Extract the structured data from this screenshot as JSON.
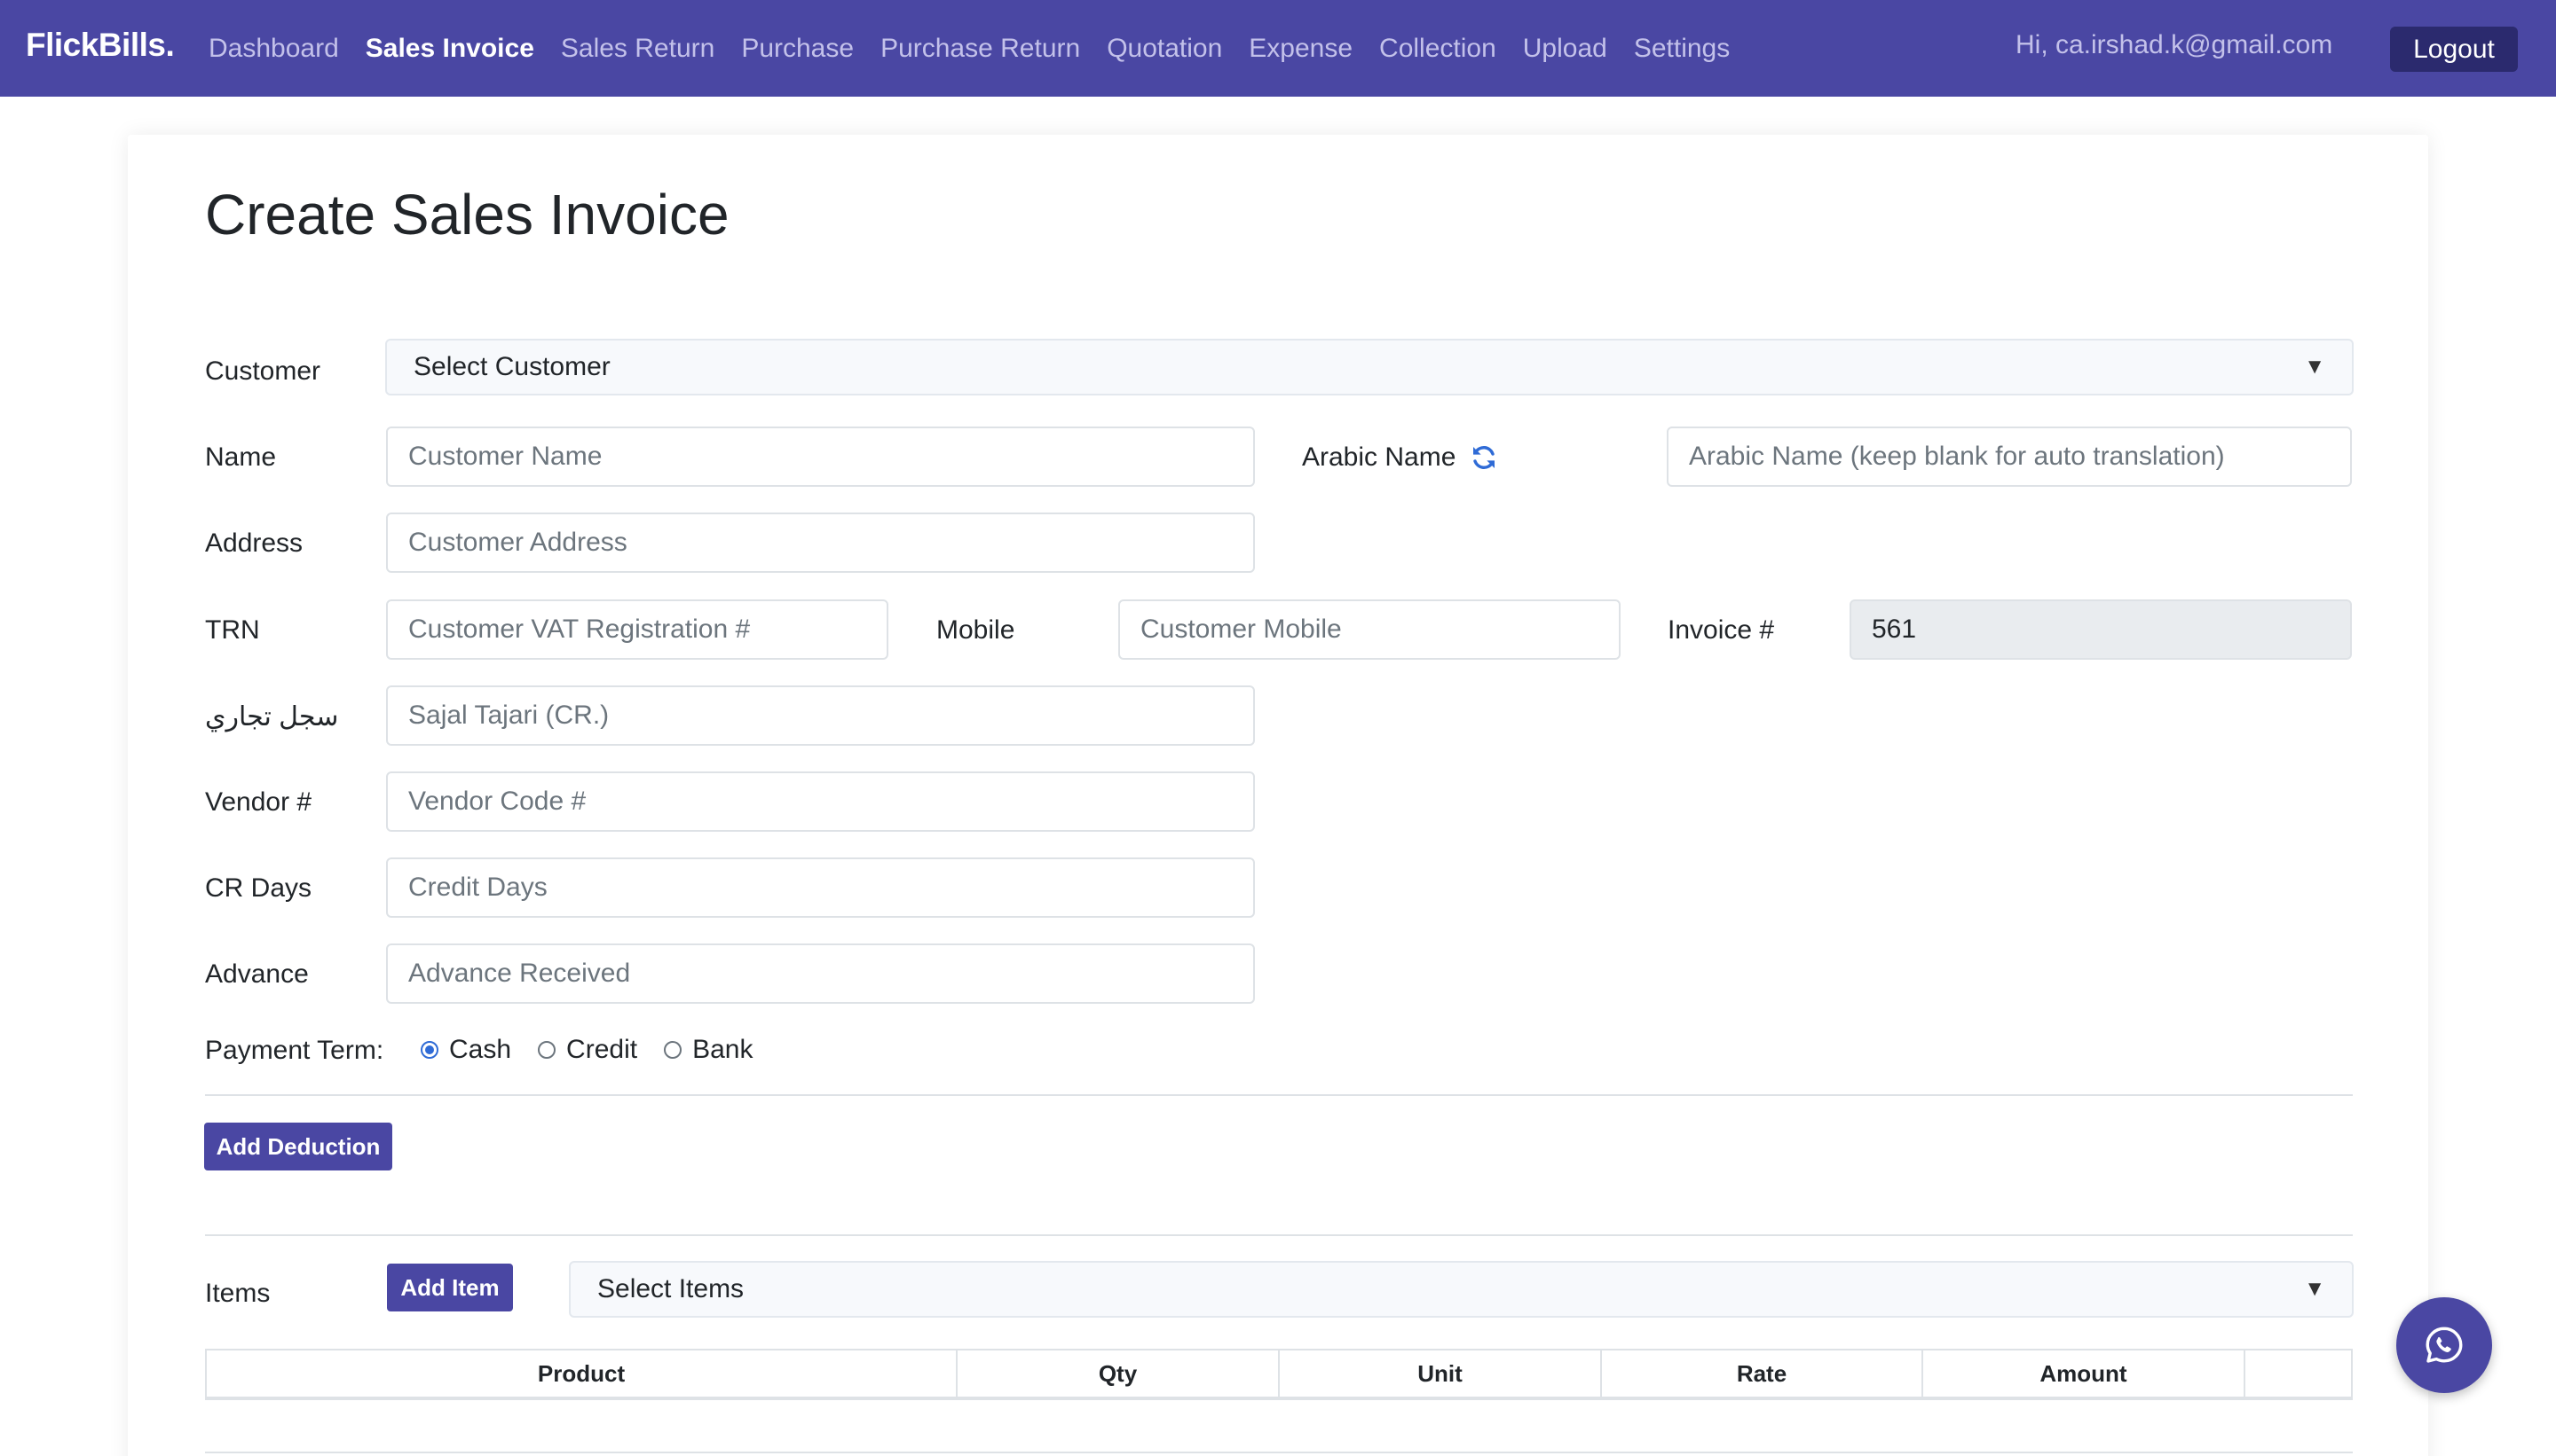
{
  "nav": {
    "brand": "FlickBills.",
    "links": [
      {
        "label": "Dashboard",
        "active": false
      },
      {
        "label": "Sales Invoice",
        "active": true
      },
      {
        "label": "Sales Return",
        "active": false
      },
      {
        "label": "Purchase",
        "active": false
      },
      {
        "label": "Purchase Return",
        "active": false
      },
      {
        "label": "Quotation",
        "active": false
      },
      {
        "label": "Expense",
        "active": false
      },
      {
        "label": "Collection",
        "active": false
      },
      {
        "label": "Upload",
        "active": false
      },
      {
        "label": "Settings",
        "active": false
      }
    ],
    "greeting": "Hi, ca.irshad.k@gmail.com",
    "logout_label": "Logout"
  },
  "page": {
    "title": "Create Sales Invoice"
  },
  "form": {
    "customer_label": "Customer",
    "customer_select": "Select Customer",
    "name_label": "Name",
    "name_placeholder": "Customer Name",
    "arabic_name_label": "Arabic Name",
    "arabic_name_placeholder": "Arabic Name (keep blank for auto translation)",
    "address_label": "Address",
    "address_placeholder": "Customer Address",
    "trn_label": "TRN",
    "trn_placeholder": "Customer VAT Registration #",
    "mobile_label": "Mobile",
    "mobile_placeholder": "Customer Mobile",
    "invoice_label": "Invoice #",
    "invoice_value": "561",
    "cr_arabic_label": "سجل تجاري",
    "cr_placeholder": "Sajal Tajari (CR.)",
    "vendor_label": "Vendor #",
    "vendor_placeholder": "Vendor Code #",
    "cr_days_label": "CR Days",
    "cr_days_placeholder": "Credit Days",
    "advance_label": "Advance",
    "advance_placeholder": "Advance Received",
    "payment_term_label": "Payment Term:",
    "payment_options": [
      {
        "label": "Cash",
        "checked": true
      },
      {
        "label": "Credit",
        "checked": false
      },
      {
        "label": "Bank",
        "checked": false
      }
    ],
    "add_deduction_label": "Add Deduction",
    "items_label": "Items",
    "add_item_label": "Add Item",
    "items_select": "Select Items"
  },
  "table": {
    "columns": [
      "Product",
      "Qty",
      "Unit",
      "Rate",
      "Amount",
      ""
    ]
  },
  "colors": {
    "primary": "#4a47a3",
    "logout_bg": "#2b2a6e",
    "radio_checked": "#2f6bd6"
  },
  "icons": {
    "refresh": "refresh-icon",
    "whatsapp": "whatsapp-icon",
    "caret": "caret-down-icon"
  }
}
